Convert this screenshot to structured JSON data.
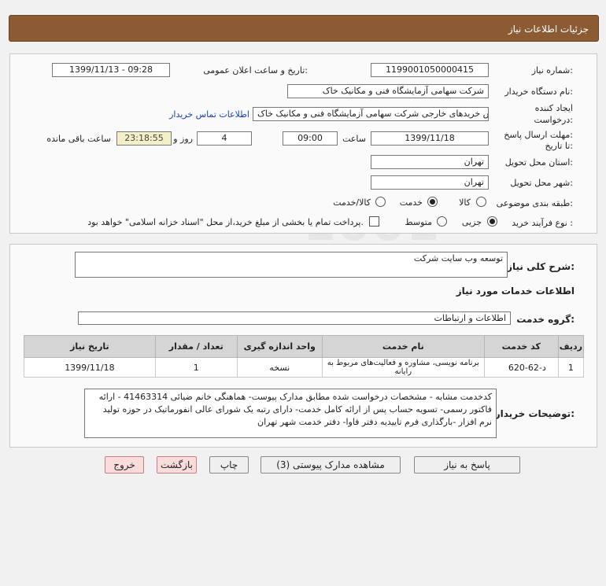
{
  "header": {
    "title": "جزئیات اطلاعات نیاز"
  },
  "info": {
    "need_number_label": "شماره نیاز:",
    "need_number": "1199001050000415",
    "announce_label": "تاریخ و ساعت اعلان عمومی:",
    "announce_value": "1399/11/13 - 09:28",
    "buyer_org_label": "نام دستگاه خریدار:",
    "buyer_org": "شرکت سهامی آزمایشگاه فنی و مکانیک خاک",
    "creator_label_1": "ایجاد کننده",
    "creator_label_2": "درخواست:",
    "creator": "محمود کلانتری کارشناس خریدهای خارجی  شرکت سهامی آزمایشگاه فنی و مکانیک خاک",
    "contact_link": "اطلاعات تماس خریدار",
    "deadline_label_1": "مهلت ارسال پاسخ:",
    "deadline_label_2": "تا تاریخ:",
    "deadline_date": "1399/11/18",
    "time_label": "ساعت",
    "deadline_time": "09:00",
    "days": "4",
    "days_label": "روز و",
    "remaining": "23:18:55",
    "remaining_label": "ساعت باقی مانده",
    "province_label": "استان محل تحویل:",
    "province": "تهران",
    "city_label": "شهر محل تحویل:",
    "city": "تهران",
    "category_label": "طبقه بندی موضوعی:",
    "category_options": [
      "کالا",
      "خدمت",
      "کالا/خدمت"
    ],
    "process_label": "نوع فرآیند خرید :",
    "process_options": [
      "جزیی",
      "متوسط"
    ],
    "payment_note": "پرداخت تمام یا بخشی از مبلغ خرید،از محل \"اسناد خزانه اسلامی\" خواهد بود."
  },
  "details": {
    "summary_label": "شرح کلی نیاز:",
    "summary": "توسعه وب سایت شرکت",
    "services_title": "اطلاعات خدمات مورد نیاز",
    "group_label": "گروه خدمت:",
    "group": "اطلاعات و ارتباطات",
    "table": {
      "headers": [
        "ردیف",
        "کد خدمت",
        "نام خدمت",
        "واحد اندازه گیری",
        "تعداد / مقدار",
        "تاریخ نیاز"
      ],
      "rows": [
        [
          "1",
          "د-62-620",
          "برنامه نویسی، مشاوره و فعالیت‌های مربوط به رایانه",
          "نسخه",
          "1",
          "1399/11/18"
        ]
      ]
    },
    "buyer_notes_label": "توضیحات خریدار:",
    "buyer_notes": "کدخدمت مشابه - مشخصات درخواست شده مطابق مدارک پیوست- هماهنگی خانم ضیائی 41463314 - ارائه فاکتور رسمی- تسویه حساب پس از ارائه کامل خدمت- دارای رتبه یک شورای عالی انفورماتیک در حوزه تولید نرم افزار -بارگذاری فرم تاییدیه دفتر فاوا- دفتر خدمت شهر تهران"
  },
  "buttons": {
    "reply": "پاسخ به نیاز",
    "attachments": "مشاهده مدارک پیوستی (3)",
    "print": "چاپ",
    "back": "بازگشت",
    "exit": "خروج"
  }
}
